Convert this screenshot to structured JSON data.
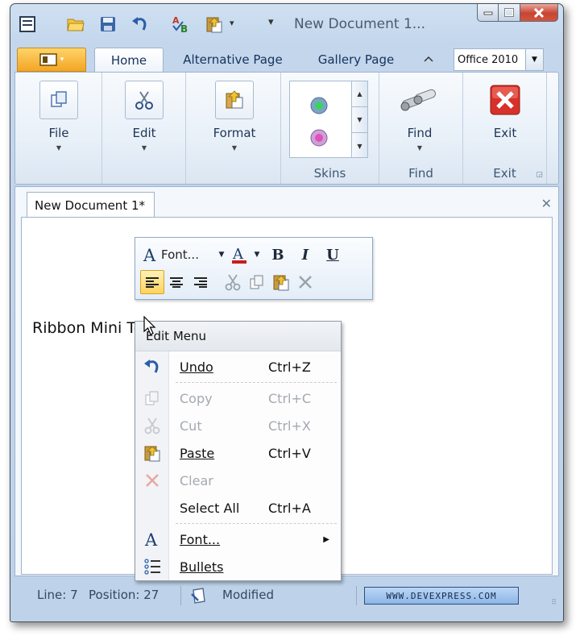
{
  "window": {
    "title": "New Document 1...",
    "controls": {
      "minimize": "minimize",
      "maximize": "maximize",
      "close": "close"
    }
  },
  "quick_access": {
    "icons": [
      "app-menu-icon",
      "open-folder-icon",
      "save-icon",
      "undo-icon",
      "spellcheck-icon",
      "paste-icon"
    ],
    "customize_glyph": "▾"
  },
  "ribbon": {
    "tabs": [
      "Home",
      "Alternative Page",
      "Gallery Page"
    ],
    "active_tab": "Home",
    "skin_selector": {
      "value": "Office 2010"
    },
    "groups": {
      "file": {
        "button": "File"
      },
      "edit": {
        "button": "Edit"
      },
      "format": {
        "button": "Format"
      },
      "skins": {
        "caption": "Skins"
      },
      "find": {
        "button": "Find",
        "caption": "Find"
      },
      "exit": {
        "button": "Exit",
        "caption": "Exit"
      }
    }
  },
  "document": {
    "tab_title": "New Document 1*",
    "body_text": "Ribbon Mini Toolbar"
  },
  "mini_toolbar": {
    "font_label": "Font...",
    "bold": "B",
    "italic": "I",
    "underline": "U"
  },
  "context_menu": {
    "header": "Edit Menu",
    "items": [
      {
        "label": "Undo",
        "shortcut": "Ctrl+Z",
        "enabled": true
      },
      {
        "label": "Copy",
        "shortcut": "Ctrl+C",
        "enabled": false
      },
      {
        "label": "Cut",
        "shortcut": "Ctrl+X",
        "enabled": false
      },
      {
        "label": "Paste",
        "shortcut": "Ctrl+V",
        "enabled": true
      },
      {
        "label": "Clear",
        "shortcut": "",
        "enabled": false
      },
      {
        "label": "Select All",
        "shortcut": "Ctrl+A",
        "enabled": true
      },
      {
        "label": "Font...",
        "shortcut": "",
        "enabled": true
      },
      {
        "label": "Bullets",
        "shortcut": "",
        "enabled": true
      }
    ]
  },
  "status_bar": {
    "line": "Line: 7",
    "position": "Position: 27",
    "state": "Modified",
    "link": "WWW.DEVEXPRESS.COM"
  },
  "colors": {
    "frame": "#c3d6ec",
    "app_button": "#f4a524",
    "close_button": "#c74433",
    "exit_icon": "#d8302a",
    "highlight": "#ffd35c"
  }
}
